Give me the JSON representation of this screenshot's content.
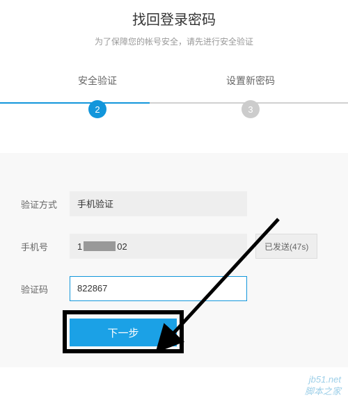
{
  "header": {
    "title": "找回登录密码",
    "subtitle": "为了保障您的帐号安全，请先进行安全验证"
  },
  "steps": {
    "step2": {
      "label": "安全验证",
      "num": "2"
    },
    "step3": {
      "label": "设置新密码",
      "num": "3"
    }
  },
  "form": {
    "method_label": "验证方式",
    "method_value": "手机验证",
    "phone_label": "手机号",
    "phone_prefix": "1",
    "phone_suffix": "02",
    "send_button": "已发送(47s)",
    "code_label": "验证码",
    "code_value": "822867",
    "submit": "下一步"
  },
  "watermark": {
    "line1": "jb51.net",
    "line2": "脚本之家"
  }
}
